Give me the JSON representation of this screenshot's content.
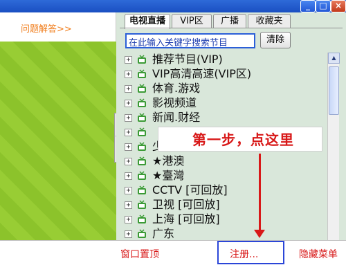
{
  "left_panel": {
    "help_link": "问题解答>>"
  },
  "tabs": [
    {
      "label": "电视直播",
      "active": true
    },
    {
      "label": "VIP区",
      "active": false
    },
    {
      "label": "广播",
      "active": false
    },
    {
      "label": "收藏夹",
      "active": false
    }
  ],
  "search": {
    "value": "在此输入关键字搜索节目",
    "clear_label": "清除"
  },
  "channels": [
    {
      "label": "推荐节目(VIP)"
    },
    {
      "label": "VIP高清高速(VIP区)"
    },
    {
      "label": "体育.游戏"
    },
    {
      "label": "影视频道"
    },
    {
      "label": "新闻.财经"
    },
    {
      "label": ""
    },
    {
      "label": "少儿.动漫"
    },
    {
      "label": "★港澳"
    },
    {
      "label": "★臺灣"
    },
    {
      "label": "CCTV [可回放]"
    },
    {
      "label": "卫视 [可回放]"
    },
    {
      "label": "上海 [可回放]"
    },
    {
      "label": "广东"
    }
  ],
  "annotation": {
    "text": "第一步，点这里"
  },
  "bottom_bar": {
    "pin_window": "窗口置顶",
    "register": "注册...",
    "hide_menu": "隐藏菜单"
  },
  "window_buttons": {
    "minimize": "_",
    "maximize": "□",
    "close": "×"
  },
  "colors": {
    "accent_blue": "#2b46d8",
    "annotation_red": "#d81818",
    "help_orange": "#f07c1a",
    "green_panel": "#8cc32b",
    "list_bg": "#d9e7da"
  }
}
